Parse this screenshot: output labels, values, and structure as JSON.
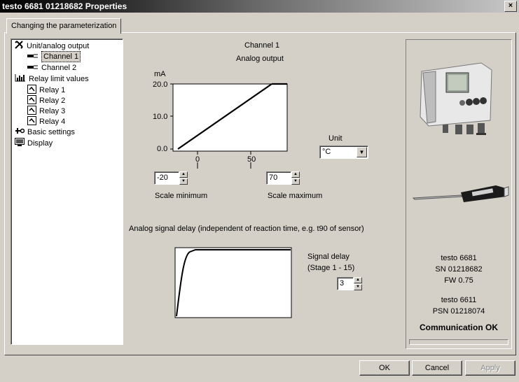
{
  "window": {
    "title": "testo 6681  01218682 Properties",
    "close_label": "×"
  },
  "tab": {
    "label": "Changing the parameterization"
  },
  "tree": {
    "unit_analog": "Unit/analog output",
    "channel1": "Channel 1",
    "channel2": "Channel 2",
    "relay_limits": "Relay limit values",
    "relay1": "Relay 1",
    "relay2": "Relay 2",
    "relay3": "Relay 3",
    "relay4": "Relay 4",
    "basic_settings": "Basic settings",
    "display": "Display"
  },
  "analog": {
    "channel_title": "Channel 1",
    "subtitle": "Analog output",
    "y_unit": "mA",
    "y_ticks": [
      "20.0",
      "10.0",
      "0.0"
    ],
    "x_ticks": [
      "0",
      "50"
    ],
    "scale_min_value": "-20",
    "scale_min_label": "Scale minimum",
    "scale_max_value": "70",
    "scale_max_label": "Scale maximum",
    "unit_label": "Unit",
    "unit_value": "°C"
  },
  "delay": {
    "heading": "Analog signal delay (independent of reaction time, e.g. t90 of sensor)",
    "label_line1": "Signal delay",
    "label_line2": "(Stage 1 - 15)",
    "value": "3"
  },
  "device": {
    "name": "testo 6681",
    "sn": "SN 01218682",
    "fw": "FW  0.75",
    "probe_name": "testo 6611",
    "psn": "PSN 01218074",
    "status": "Communication OK"
  },
  "buttons": {
    "ok": "OK",
    "cancel": "Cancel",
    "apply": "Apply"
  }
}
